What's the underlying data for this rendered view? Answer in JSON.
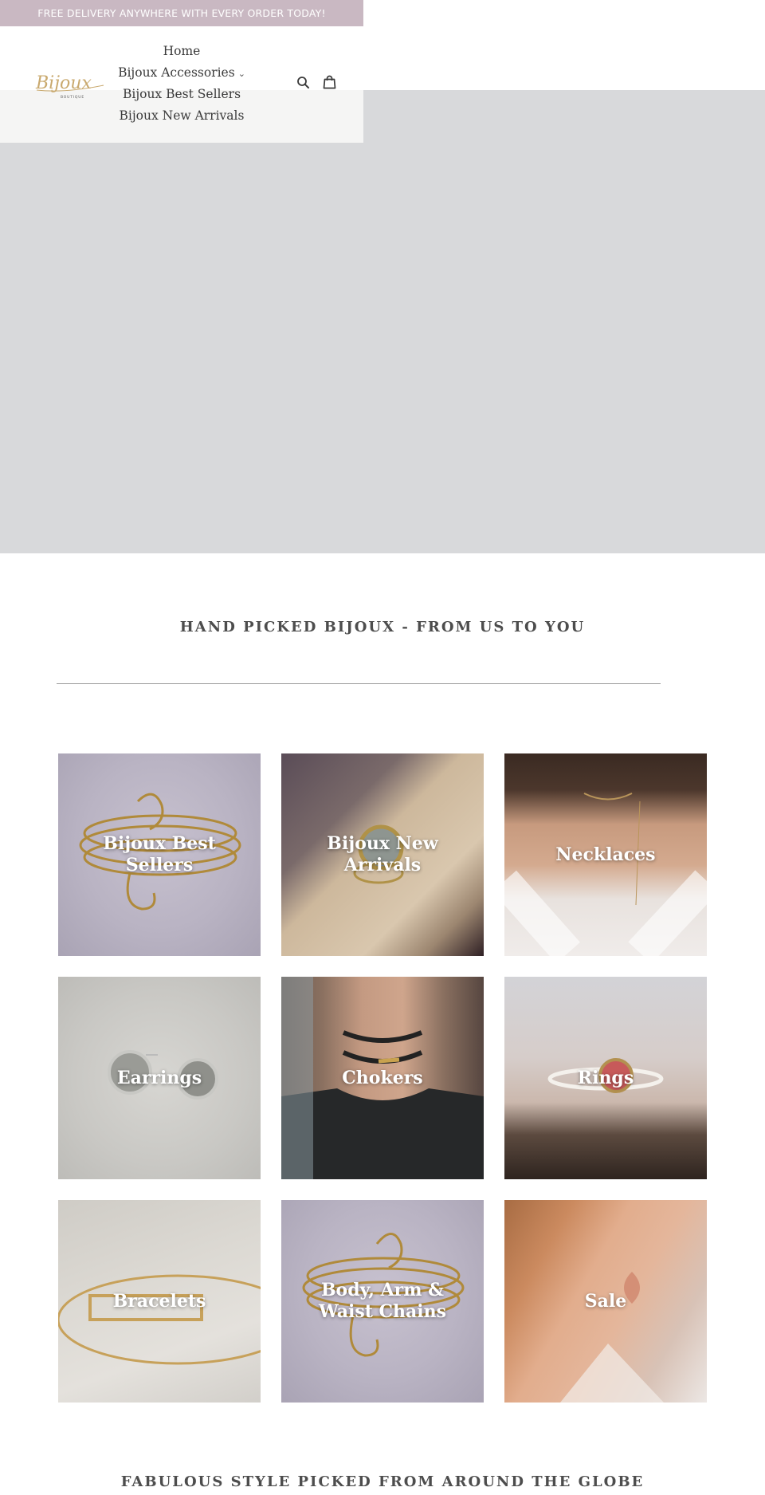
{
  "announcement": {
    "text": "FREE DELIVERY ANYWHERE WITH EVERY ORDER TODAY!"
  },
  "header": {
    "logo": {
      "wordmark": "Bijoux",
      "subtext": "BOUTIQUE"
    },
    "nav": [
      {
        "label": "Home"
      },
      {
        "label": "Bijoux Accessories",
        "has_dropdown": true,
        "chevron": "⌄"
      },
      {
        "label": "Bijoux Best Sellers"
      },
      {
        "label": "Bijoux New Arrivals"
      }
    ],
    "icons": [
      "search-icon",
      "cart-icon"
    ]
  },
  "hero": {
    "color": "#d8d9db"
  },
  "sections": {
    "collections_heading": "HAND PICKED BIJOUX - FROM US TO YOU",
    "footer_heading": "FABULOUS STYLE PICKED FROM AROUND THE GLOBE"
  },
  "collections": [
    {
      "label": "Bijoux Best Sellers",
      "image": "gold-spiral-arm-cuff"
    },
    {
      "label": "Bijoux New Arrivals",
      "image": "moonstone-ring-on-box"
    },
    {
      "label": "Necklaces",
      "image": "woman-choker-necklace"
    },
    {
      "label": "Earrings",
      "image": "moonstone-stud-earrings"
    },
    {
      "label": "Chokers",
      "image": "black-cord-choker"
    },
    {
      "label": "Rings",
      "image": "pink-stone-ring"
    },
    {
      "label": "Bracelets",
      "image": "gold-bangle"
    },
    {
      "label": "Body, Arm & Waist Chains",
      "image": "gold-spiral-arm-cuff"
    },
    {
      "label": "Sale",
      "image": "woman-neck-closeup"
    }
  ],
  "colors": {
    "announcement_bg": "#c9b8c2",
    "text": "#3a3a3a",
    "logo_gold": "#c9a96e"
  }
}
